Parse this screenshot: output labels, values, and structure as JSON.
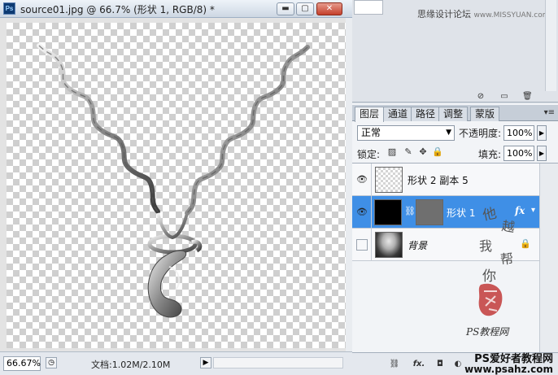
{
  "document": {
    "app_icon": "Ps",
    "title": "source01.jpg @ 66.7% (形状 1, RGB/8) *",
    "window_buttons": {
      "minimize": "▬",
      "restore": "▢",
      "close": "✕"
    },
    "icons": [
      "photoshop-icon",
      "minimize-icon",
      "restore-icon",
      "close-icon"
    ]
  },
  "statusbar": {
    "zoom": "66.67%",
    "doc_size": "文档:1.02M/2.10M",
    "nav_left": "◷",
    "nav_right": "▶"
  },
  "top_panel": {
    "forum_text": "思缘设计论坛",
    "forum_url": "www.MISSYUAN.com",
    "bottom_icons": [
      "⊘",
      "▭",
      "🗑"
    ]
  },
  "layers_panel": {
    "tabs": [
      {
        "label": "图层",
        "active": true
      },
      {
        "label": "通道",
        "active": false
      },
      {
        "label": "路径",
        "active": false
      },
      {
        "label": "调整",
        "active": false
      },
      {
        "label": "蒙版",
        "active": false
      }
    ],
    "menu_icon": "▾≡",
    "blend_mode": "正常",
    "opacity_label": "不透明度:",
    "opacity_value": "100%",
    "lock_label": "锁定:",
    "lock_icons": [
      "▨",
      "✎",
      "✥",
      "🔒"
    ],
    "fill_label": "填充:",
    "fill_value": "100%",
    "layers": [
      {
        "name": "形状 2 副本 5",
        "visible": true,
        "selected": false
      },
      {
        "name": "形状 1",
        "visible": true,
        "selected": true,
        "fx": "fx"
      },
      {
        "name": "背景",
        "visible": false,
        "selected": false,
        "locked": true
      }
    ],
    "bottom_icons": [
      "⛓",
      "fx.",
      "◘",
      "◐"
    ],
    "watermark_chars": [
      "他",
      "越",
      "我",
      "帮",
      "你"
    ],
    "watermark_script": "PS教程网",
    "site_text": "PS爱好者教程网",
    "site_url": "www.psahz.com"
  }
}
